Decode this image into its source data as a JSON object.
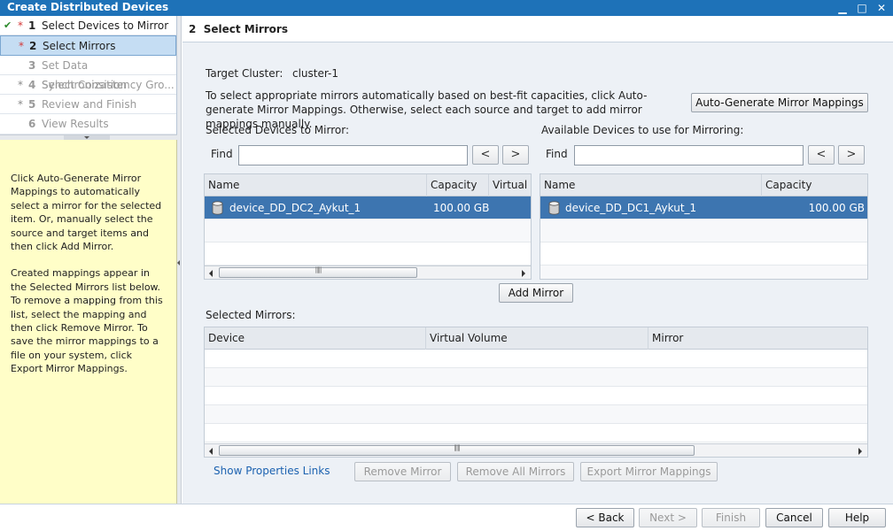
{
  "window": {
    "title": "Create Distributed Devices",
    "controls": {
      "minimize": "▁",
      "maximize": "□",
      "close": "✕"
    }
  },
  "steps": [
    {
      "check": "✔",
      "star": "*",
      "num": "1",
      "label": "Select Devices to Mirror",
      "state": "done"
    },
    {
      "check": "",
      "star": "*",
      "num": "2",
      "label": "Select Mirrors",
      "state": "active"
    },
    {
      "check": "",
      "star": "",
      "num": "3",
      "label": "Set Data Synchronization",
      "state": "disabled"
    },
    {
      "check": "",
      "star": "*",
      "num": "4",
      "label": "Select Consistency Gro...",
      "state": "disabled"
    },
    {
      "check": "",
      "star": "*",
      "num": "5",
      "label": "Review and Finish",
      "state": "disabled"
    },
    {
      "check": "",
      "star": "",
      "num": "6",
      "label": "View Results",
      "state": "disabled"
    }
  ],
  "help": {
    "para1": "Click Auto-Generate Mirror Mappings to automatically select a mirror for the selected item.  Or, manually select the source and target items and then click Add Mirror.",
    "para2": "Created mappings appear in the Selected Mirrors list below.  To remove a mapping from this list, select the mapping and then click Remove Mirror.  To save the mirror mappings to a file on your system, click Export Mirror Mappings."
  },
  "header": {
    "num": "2",
    "title": "Select Mirrors"
  },
  "target_cluster": {
    "label": "Target Cluster:",
    "value": "cluster-1"
  },
  "instructions": "To select appropriate mirrors automatically based on best-fit capacities, click Auto-generate Mirror Mappings. Otherwise, select each source and target to add mirror mappings manually.",
  "auto_generate_label": "Auto-Generate Mirror Mappings",
  "left_panel": {
    "title": "Selected Devices to Mirror:",
    "find_label": "Find",
    "find_value": "",
    "prev": "<",
    "next": ">",
    "columns": [
      "Name",
      "Capacity",
      "Virtual Volume"
    ],
    "rows": [
      {
        "name": "device_DD_DC2_Aykut_1",
        "capacity": "100.00 GB",
        "virtual_volume": ""
      }
    ]
  },
  "right_panel": {
    "title": "Available Devices to use for Mirroring:",
    "find_label": "Find",
    "find_value": "",
    "prev": "<",
    "next": ">",
    "columns": [
      "Name",
      "Capacity"
    ],
    "rows": [
      {
        "name": "device_DD_DC1_Aykut_1",
        "capacity": "100.00 GB"
      }
    ]
  },
  "add_mirror_label": "Add Mirror",
  "selected_mirrors": {
    "title": "Selected Mirrors:",
    "columns": [
      "Device",
      "Virtual Volume",
      "Mirror"
    ]
  },
  "show_properties_label": "Show Properties Links",
  "remove_mirror_label": "Remove Mirror",
  "remove_all_label": "Remove All Mirrors",
  "export_label": "Export Mirror Mappings",
  "footer": {
    "back": "< Back",
    "next": "Next >",
    "finish": "Finish",
    "cancel": "Cancel",
    "help": "Help"
  }
}
